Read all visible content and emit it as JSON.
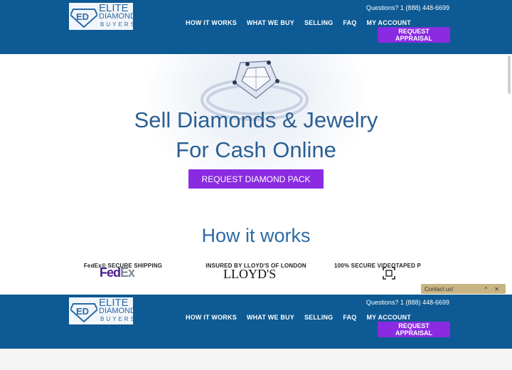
{
  "header": {
    "logo": {
      "line1": "ELITE",
      "line2": "DIAMOND",
      "line3": "BUYERS"
    },
    "phone": "Questions? 1 (888) 448-6699",
    "nav": [
      "HOW IT WORKS",
      "WHAT WE BUY",
      "SELLING",
      "FAQ",
      "MY ACCOUNT"
    ],
    "cta": "REQUEST APPRAISAL"
  },
  "hero": {
    "title_line1": "Sell Diamonds & Jewelry",
    "title_line2": "For Cash Online",
    "cta": "REQUEST DIAMOND PACK"
  },
  "how": {
    "title": "How it works",
    "features": [
      {
        "logo_fe": "Fed",
        "logo_ex": "Ex",
        "label": "FedEx® SECURE SHIPPING"
      },
      {
        "logo_text": "LLOYD'S",
        "label": "INSURED BY LLOYD'S OF LONDON"
      },
      {
        "label": "100% SECURE VIDEOTAPED P"
      }
    ]
  },
  "contact": {
    "label": "Contact us!",
    "controls": "^ ✕"
  },
  "colors": {
    "header": "#0d5a94",
    "accent": "#8a2be2",
    "title": "#2b5f93"
  }
}
